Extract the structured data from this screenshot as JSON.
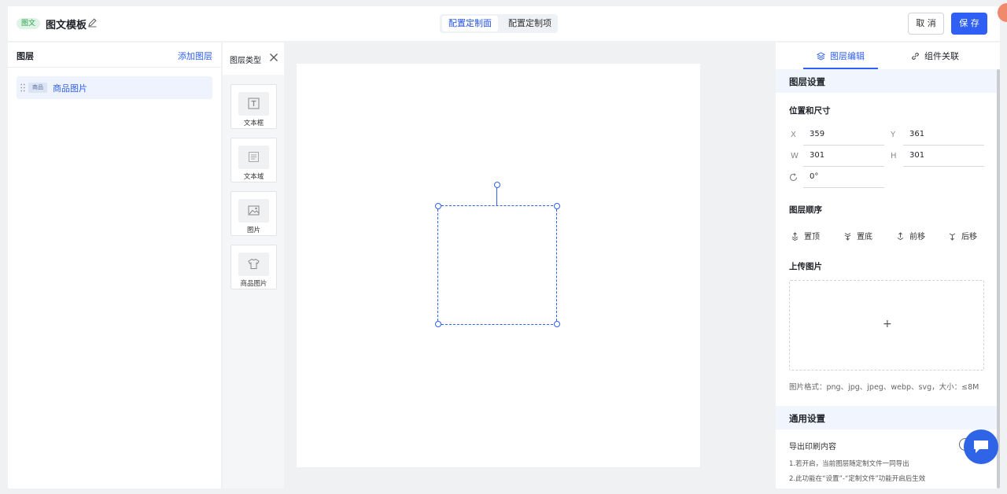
{
  "header": {
    "tag": "图文",
    "title": "图文模板",
    "tabs": [
      {
        "label": "配置定制面",
        "active": true
      },
      {
        "label": "配置定制项",
        "active": false
      }
    ],
    "cancel_label": "取 消",
    "save_label": "保 存"
  },
  "layers_panel": {
    "title": "图层",
    "add_label": "添加图层",
    "items": [
      {
        "tag": "商品",
        "name": "商品图片"
      }
    ]
  },
  "layer_types": {
    "title": "图层类型",
    "items": [
      {
        "label": "文本框",
        "icon": "text-box-icon"
      },
      {
        "label": "文本域",
        "icon": "text-area-icon"
      },
      {
        "label": "图片",
        "icon": "image-icon"
      },
      {
        "label": "商品图片",
        "icon": "tshirt-icon"
      }
    ]
  },
  "properties": {
    "tabs": [
      {
        "label": "图层编辑",
        "icon": "layers-icon",
        "active": true
      },
      {
        "label": "组件关联",
        "icon": "link-icon",
        "active": false
      }
    ],
    "layer_settings_title": "图层设置",
    "position_title": "位置和尺寸",
    "x_label": "X",
    "x_value": "359",
    "y_label": "Y",
    "y_value": "361",
    "w_label": "W",
    "w_value": "301",
    "h_label": "H",
    "h_value": "301",
    "rotation_value": "0°",
    "order_title": "图层顺序",
    "order_items": [
      "置顶",
      "置底",
      "前移",
      "后移"
    ],
    "upload_title": "上传图片",
    "upload_plus": "+",
    "upload_hint": "图片格式：png、jpg、jpeg、webp、svg，大小：≤8M",
    "general_title": "通用设置",
    "export_label": "导出印刷内容",
    "notes": [
      "1.若开启，当前图层随定制文件一同导出",
      "2.此功能在“设置”-“定制文件”功能开启后生效"
    ]
  },
  "colors": {
    "accent": "#2f5ff5",
    "tag_bg": "#dff3e6",
    "tag_text": "#2ba24c"
  }
}
